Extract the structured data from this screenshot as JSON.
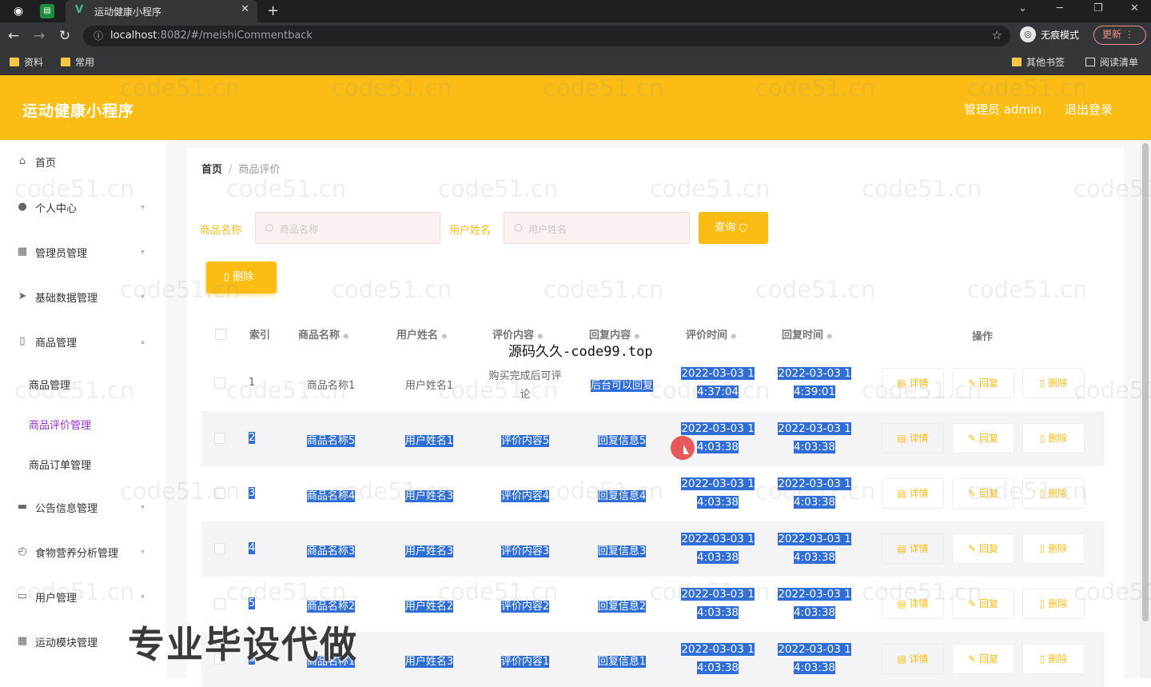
{
  "browser": {
    "tab_title": "运动健康小程序",
    "url_host": "localhost",
    "url_rest": ":8082/#/meishiCommentback",
    "incognito_label": "无痕模式",
    "update_label": "更新",
    "bookmarks": [
      "资料",
      "常用"
    ],
    "bookmarks_right": [
      "其他书签",
      "阅读清单"
    ]
  },
  "header": {
    "title": "运动健康小程序",
    "user": "管理员 admin",
    "logout": "退出登录"
  },
  "sidebar": {
    "items": [
      {
        "label": "首页",
        "icon": "home-icon"
      },
      {
        "label": "个人中心",
        "icon": "user-icon"
      },
      {
        "label": "管理员管理",
        "icon": "grid-icon"
      },
      {
        "label": "基础数据管理",
        "icon": "send-icon"
      },
      {
        "label": "商品管理",
        "icon": "phone-icon"
      },
      {
        "label": "公告信息管理",
        "icon": "briefcase-icon"
      },
      {
        "label": "食物营养分析管理",
        "icon": "compass-icon"
      },
      {
        "label": "用户管理",
        "icon": "chat-icon"
      },
      {
        "label": "运动模块管理",
        "icon": "grid-icon"
      }
    ],
    "sub_items": [
      "商品管理",
      "商品评价管理",
      "商品订单管理"
    ]
  },
  "breadcrumb": {
    "home": "首页",
    "current": "商品评价"
  },
  "search": {
    "goods_label": "商品名称",
    "goods_placeholder": "商品名称",
    "user_label": "用户姓名",
    "user_placeholder": "用户姓名",
    "query_label": "查询"
  },
  "delete_label": "删除",
  "table": {
    "headers": [
      "索引",
      "商品名称",
      "用户姓名",
      "评价内容",
      "回复内容",
      "评价时间",
      "回复时间",
      "操作"
    ],
    "rows": [
      {
        "index": "1",
        "goods": "商品名称1",
        "user": "用户姓名1",
        "content1": "购买完成后可评",
        "content2": "论",
        "reply": "后台可以回复",
        "t1a": "2022-03-03 1",
        "t1b": "4:37:04",
        "t2a": "2022-03-03 1",
        "t2b": "4:39:01"
      },
      {
        "index": "2",
        "goods": "商品名称5",
        "user": "用户姓名1",
        "content1": "评价内容5",
        "content2": "",
        "reply": "回复信息5",
        "t1a": "2022-03-03 1",
        "t1b": "4:03:38",
        "t2a": "2022-03-03 1",
        "t2b": "4:03:38"
      },
      {
        "index": "3",
        "goods": "商品名称4",
        "user": "用户姓名3",
        "content1": "评价内容4",
        "content2": "",
        "reply": "回复信息4",
        "t1a": "2022-03-03 1",
        "t1b": "4:03:38",
        "t2a": "2022-03-03 1",
        "t2b": "4:03:38"
      },
      {
        "index": "4",
        "goods": "商品名称3",
        "user": "用户姓名3",
        "content1": "评价内容3",
        "content2": "",
        "reply": "回复信息3",
        "t1a": "2022-03-03 1",
        "t1b": "4:03:38",
        "t2a": "2022-03-03 1",
        "t2b": "4:03:38"
      },
      {
        "index": "5",
        "goods": "商品名称2",
        "user": "用户姓名2",
        "content1": "评价内容2",
        "content2": "",
        "reply": "回复信息2",
        "t1a": "2022-03-03 1",
        "t1b": "4:03:38",
        "t2a": "2022-03-03 1",
        "t2b": "4:03:38"
      },
      {
        "index": "6",
        "goods": "商品名称1",
        "user": "用户姓名3",
        "content1": "评价内容1",
        "content2": "",
        "reply": "回复信息1",
        "t1a": "2022-03-03 1",
        "t1b": "4:03:38",
        "t2a": "2022-03-03 1",
        "t2b": "4:03:38"
      }
    ],
    "op_detail": "详情",
    "op_reply": "回复",
    "op_delete": "删除"
  },
  "overlays": {
    "watermark": "code51.cn",
    "top_text": "源码久久-code99.top",
    "bottom_text": "专业毕设代做"
  },
  "colors": {
    "accent": "#fbbd14",
    "selection": "#2f6ed8",
    "active_menu": "#9b2fd6"
  }
}
